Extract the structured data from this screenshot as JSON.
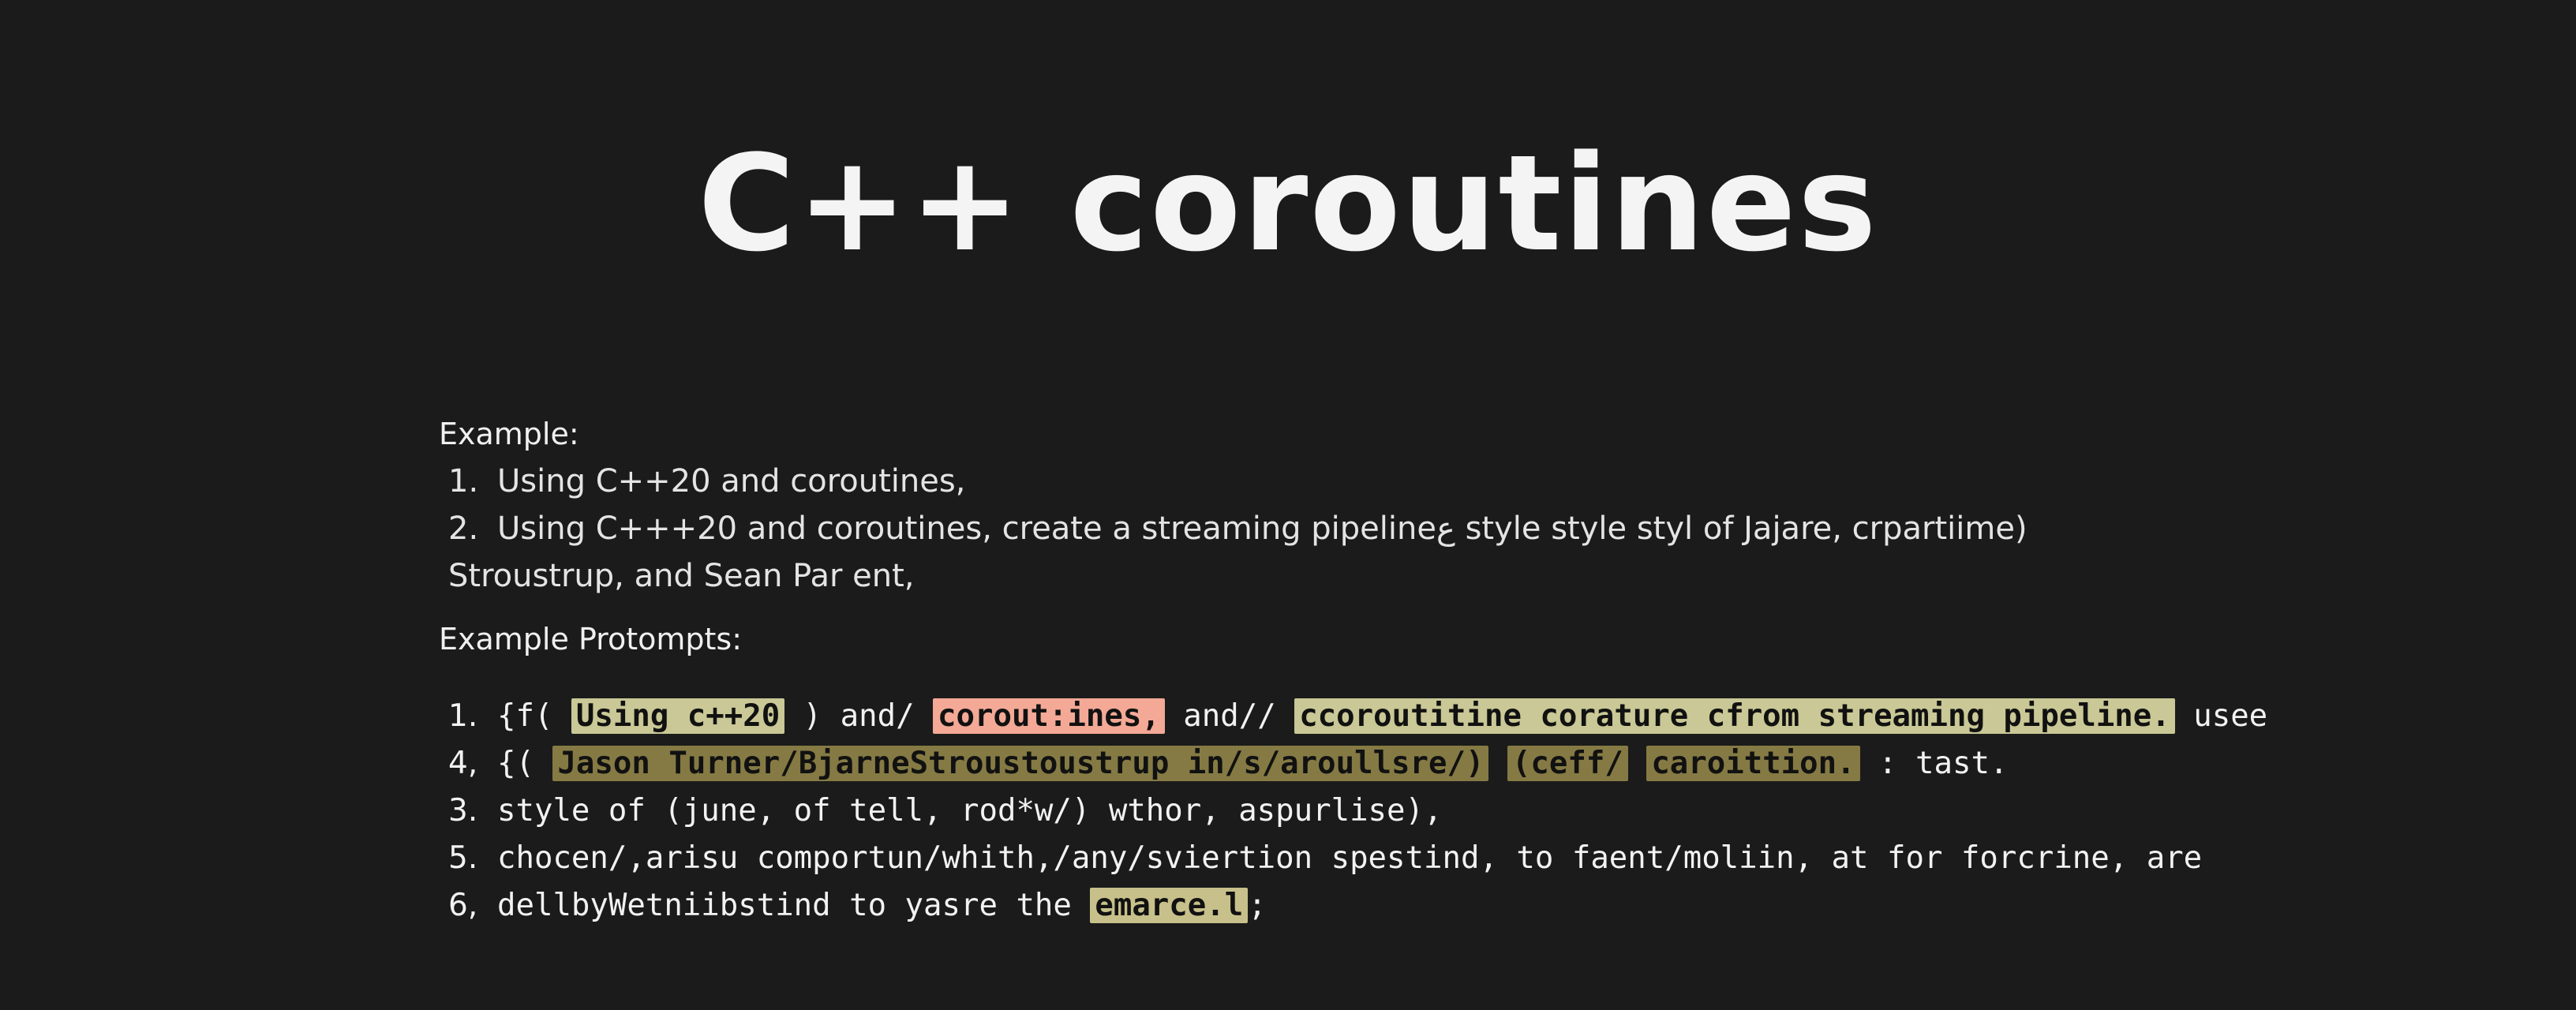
{
  "title": "C++ coroutines",
  "example": {
    "label": "Example:",
    "lines": [
      {
        "num": "1.",
        "text": "Using C++20 and coroutines,"
      },
      {
        "num": "2.",
        "text": "Using C+++20 and coroutines, create a streaming pipelineع style style styl of Jajare, crpartiime)"
      },
      {
        "num": "",
        "text": "Stroustrup, and Sean Par ent,"
      }
    ]
  },
  "prompts": {
    "label": "Example Protompts:",
    "lines": [
      {
        "num": "1.",
        "segments": [
          {
            "text": "{f( ",
            "hl": ""
          },
          {
            "text": "Using c++20",
            "hl": "olive"
          },
          {
            "text": " ) and/ ",
            "hl": ""
          },
          {
            "text": "corout:ines,",
            "hl": "salmon"
          },
          {
            "text": " and// ",
            "hl": ""
          },
          {
            "text": "ccoroutitine corature cfrom streaming pipeline.",
            "hl": "olive"
          },
          {
            "text": " usee",
            "hl": ""
          }
        ]
      },
      {
        "num": "4,",
        "segments": [
          {
            "text": "{( ",
            "hl": ""
          },
          {
            "text": "Jason Turner/BjarneStroustoustrup in/s/aroullsre/)",
            "hl": "dark"
          },
          {
            "text": " ",
            "hl": ""
          },
          {
            "text": "(ceff/",
            "hl": "dark"
          },
          {
            "text": " ",
            "hl": ""
          },
          {
            "text": "caroittion.",
            "hl": "dark"
          },
          {
            "text": " : tast.",
            "hl": ""
          }
        ]
      },
      {
        "num": "3.",
        "segments": [
          {
            "text": "style of (june, of tell, rod*w/) wthor, aspurlise),",
            "hl": ""
          }
        ]
      },
      {
        "num": "5.",
        "segments": [
          {
            "text": "chocen/,arisu comportun/whith,/any/sviertion spestind, to faent/moliin, at for forcrine, are",
            "hl": ""
          }
        ]
      },
      {
        "num": "6,",
        "segments": [
          {
            "text": "dellbyWetniibstind to yasre the ",
            "hl": ""
          },
          {
            "text": "emarce.l",
            "hl": "pale"
          },
          {
            "text": ";",
            "hl": ""
          }
        ]
      }
    ]
  }
}
